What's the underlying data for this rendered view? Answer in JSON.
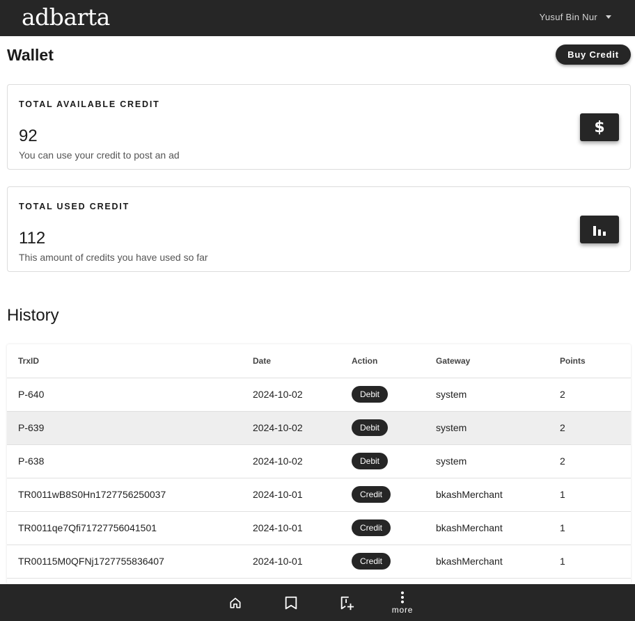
{
  "header": {
    "logo_text": "adbarta",
    "user_name": "Yusuf Bin Nur"
  },
  "page": {
    "title": "Wallet",
    "buy_button_label": "Buy Credit"
  },
  "cards": {
    "available": {
      "label": "TOTAL AVAILABLE CREDIT",
      "value": "92",
      "description": "You can use your credit to post an ad",
      "icon": "dollar-icon"
    },
    "used": {
      "label": "TOTAL USED CREDIT",
      "value": "112",
      "description": "This amount of credits you have used so far",
      "icon": "bar-chart-icon"
    }
  },
  "history": {
    "title": "History",
    "columns": [
      "TrxID",
      "Date",
      "Action",
      "Gateway",
      "Points"
    ],
    "rows": [
      {
        "trxid": "P-640",
        "date": "2024-10-02",
        "action": "Debit",
        "gateway": "system",
        "points": "2"
      },
      {
        "trxid": "P-639",
        "date": "2024-10-02",
        "action": "Debit",
        "gateway": "system",
        "points": "2"
      },
      {
        "trxid": "P-638",
        "date": "2024-10-02",
        "action": "Debit",
        "gateway": "system",
        "points": "2"
      },
      {
        "trxid": "TR0011wB8S0Hn1727756250037",
        "date": "2024-10-01",
        "action": "Credit",
        "gateway": "bkashMerchant",
        "points": "1"
      },
      {
        "trxid": "TR0011qe7Qfi71727756041501",
        "date": "2024-10-01",
        "action": "Credit",
        "gateway": "bkashMerchant",
        "points": "1"
      },
      {
        "trxid": "TR00115M0QFNj1727755836407",
        "date": "2024-10-01",
        "action": "Credit",
        "gateway": "bkashMerchant",
        "points": "1"
      }
    ]
  },
  "bottom_nav": {
    "items": [
      {
        "icon": "home-icon"
      },
      {
        "icon": "bookmark-icon"
      },
      {
        "icon": "bookmark-add-icon"
      },
      {
        "icon": "more-vert-icon",
        "label": "more"
      }
    ]
  },
  "colors": {
    "bar_background": "#262626",
    "highlight_row": "#eeeeee"
  }
}
